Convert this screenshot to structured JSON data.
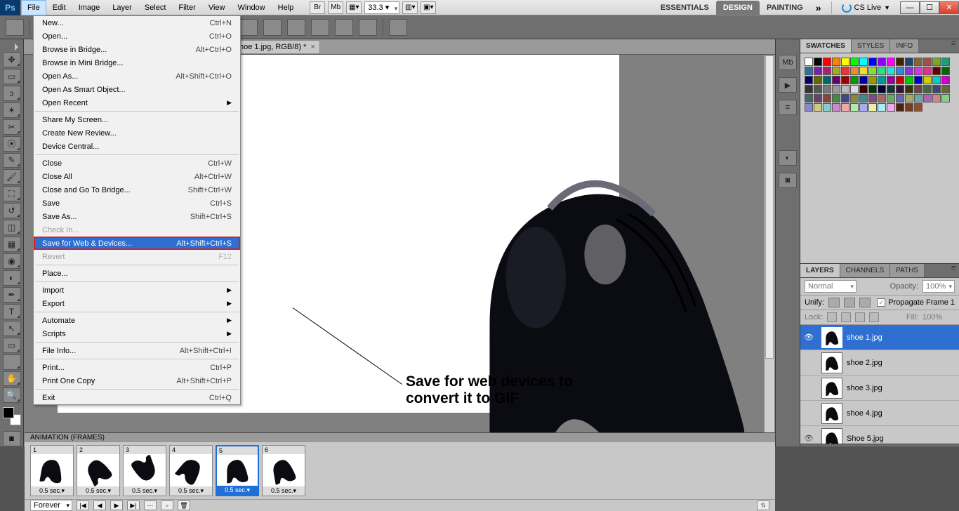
{
  "app": {
    "logo": "Ps",
    "zoom": "33.3"
  },
  "menus": [
    "File",
    "Edit",
    "Image",
    "Layer",
    "Select",
    "Filter",
    "View",
    "Window",
    "Help"
  ],
  "workspaces": {
    "tabs": [
      "ESSENTIALS",
      "DESIGN",
      "PAINTING"
    ],
    "active": 1,
    "cslive": "CS Live"
  },
  "doc_tab": "hoe 1.jpg, RGB/8) *",
  "file_menu": [
    {
      "label": "New...",
      "sc": "Ctrl+N"
    },
    {
      "label": "Open...",
      "sc": "Ctrl+O"
    },
    {
      "label": "Browse in Bridge...",
      "sc": "Alt+Ctrl+O"
    },
    {
      "label": "Browse in Mini Bridge..."
    },
    {
      "label": "Open As...",
      "sc": "Alt+Shift+Ctrl+O"
    },
    {
      "label": "Open As Smart Object..."
    },
    {
      "label": "Open Recent",
      "sub": true
    },
    {
      "sep": true
    },
    {
      "label": "Share My Screen..."
    },
    {
      "label": "Create New Review..."
    },
    {
      "label": "Device Central..."
    },
    {
      "sep": true
    },
    {
      "label": "Close",
      "sc": "Ctrl+W"
    },
    {
      "label": "Close All",
      "sc": "Alt+Ctrl+W"
    },
    {
      "label": "Close and Go To Bridge...",
      "sc": "Shift+Ctrl+W"
    },
    {
      "label": "Save",
      "sc": "Ctrl+S"
    },
    {
      "label": "Save As...",
      "sc": "Shift+Ctrl+S"
    },
    {
      "label": "Check In...",
      "disabled": true
    },
    {
      "label": "Save for Web & Devices...",
      "sc": "Alt+Shift+Ctrl+S",
      "hl": true
    },
    {
      "label": "Revert",
      "sc": "F12",
      "disabled": true
    },
    {
      "sep": true
    },
    {
      "label": "Place..."
    },
    {
      "sep": true
    },
    {
      "label": "Import",
      "sub": true
    },
    {
      "label": "Export",
      "sub": true
    },
    {
      "sep": true
    },
    {
      "label": "Automate",
      "sub": true
    },
    {
      "label": "Scripts",
      "sub": true
    },
    {
      "sep": true
    },
    {
      "label": "File Info...",
      "sc": "Alt+Shift+Ctrl+I"
    },
    {
      "sep": true
    },
    {
      "label": "Print...",
      "sc": "Ctrl+P"
    },
    {
      "label": "Print One Copy",
      "sc": "Alt+Shift+Ctrl+P"
    },
    {
      "sep": true
    },
    {
      "label": "Exit",
      "sc": "Ctrl+Q"
    }
  ],
  "annotation": "Save for web devices to convert it to GIF",
  "swatch_colors": [
    "#fff",
    "#000",
    "#f00",
    "#ff8000",
    "#ff0",
    "#0f0",
    "#0ff",
    "#00f",
    "#80f",
    "#f0f",
    "#420",
    "#246",
    "#863",
    "#954",
    "#7a2",
    "#297",
    "#279",
    "#72a",
    "#a27",
    "#aa2",
    "#e33",
    "#e83",
    "#ed3",
    "#8d3",
    "#3d8",
    "#3dd",
    "#38d",
    "#83d",
    "#d3d",
    "#d38",
    "#600",
    "#060",
    "#006",
    "#660",
    "#066",
    "#606",
    "#900",
    "#090",
    "#009",
    "#990",
    "#099",
    "#909",
    "#c00",
    "#0c0",
    "#00c",
    "#cc0",
    "#0cc",
    "#c0c",
    "#333",
    "#555",
    "#777",
    "#999",
    "#bbb",
    "#ddd",
    "#300",
    "#030",
    "#003",
    "#133",
    "#313",
    "#331",
    "#644",
    "#464",
    "#446",
    "#664",
    "#466",
    "#646",
    "#844",
    "#484",
    "#448",
    "#884",
    "#488",
    "#848",
    "#a66",
    "#6a6",
    "#66a",
    "#aa6",
    "#6aa",
    "#a6a",
    "#c88",
    "#8c8",
    "#88c",
    "#cc8",
    "#8cc",
    "#c8c",
    "#eaa",
    "#aea",
    "#aae",
    "#eea",
    "#aee",
    "#eae",
    "#502010",
    "#704020",
    "#905030"
  ],
  "panels": {
    "swatches_tabs": [
      "SWATCHES",
      "STYLES",
      "INFO"
    ],
    "layers_tabs": [
      "LAYERS",
      "CHANNELS",
      "PATHS"
    ],
    "blend": "Normal",
    "opacity_label": "Opacity:",
    "opacity_val": "100%",
    "unify": "Unify:",
    "propagate": "Propagate Frame 1",
    "lock": "Lock:",
    "fill_label": "Fill:",
    "fill_val": "100%",
    "layers": [
      {
        "name": "shoe 1.jpg",
        "sel": true,
        "eye": true
      },
      {
        "name": "shoe 2.jpg"
      },
      {
        "name": "shoe 3.jpg"
      },
      {
        "name": "shoe 4.jpg"
      },
      {
        "name": "Shoe 5.jpg",
        "eye": true
      }
    ]
  },
  "animation": {
    "title": "ANIMATION (FRAMES)",
    "frames": [
      {
        "n": "1",
        "dur": "0.5 sec.▾"
      },
      {
        "n": "2",
        "dur": "0.5 sec.▾"
      },
      {
        "n": "3",
        "dur": "0.5 sec.▾"
      },
      {
        "n": "4",
        "dur": "0.5 sec.▾"
      },
      {
        "n": "5",
        "dur": "0.5 sec.▾",
        "sel": true
      },
      {
        "n": "6",
        "dur": "0.5 sec.▾"
      }
    ],
    "loop": "Forever"
  },
  "frame_rotations": [
    10,
    -25,
    160,
    40,
    0,
    -10
  ]
}
